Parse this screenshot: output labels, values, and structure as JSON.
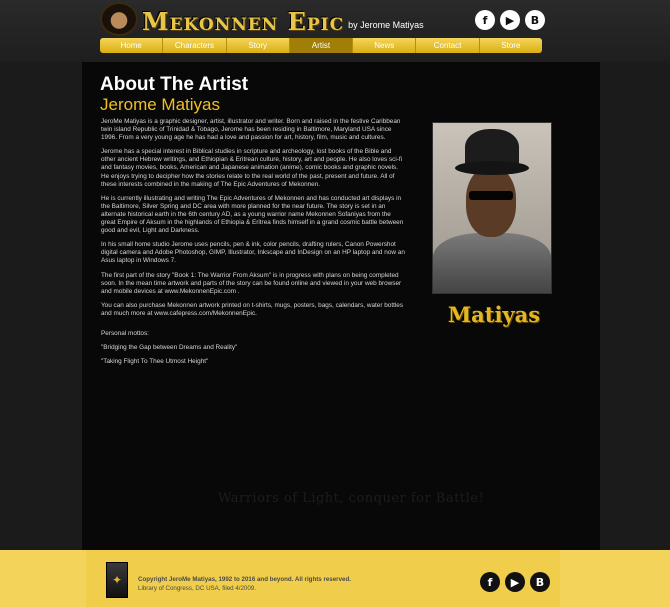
{
  "header": {
    "logo_text": "Mekonnen Epic",
    "byline": "by Jerome Matiyas",
    "social": [
      {
        "icon": "facebook-icon",
        "glyph": "f"
      },
      {
        "icon": "youtube-icon",
        "glyph": "▶"
      },
      {
        "icon": "blogger-icon",
        "glyph": "B"
      }
    ]
  },
  "nav": {
    "items": [
      "Home",
      "Characters",
      "Story",
      "Artist",
      "News",
      "Contact",
      "Store"
    ],
    "active": "Artist"
  },
  "main": {
    "title": "About The Artist",
    "artist_name": "Jerome Matiyas",
    "paragraphs": [
      "JeroMe Matiyas is a graphic designer, artist, illustrator and writer. Born and raised in the festive Caribbean twin island Republic of Trinidad & Tobago, Jerome has been residing in Baltimore, Maryland USA since 1996. From a very young age he has had a love and passion for art, history, film, music and cultures.",
      "Jerome has a special interest in Biblical studies in scripture and archeology, lost books of the Bible and other ancient Hebrew writings, and Ethiopian & Eritrean culture, history, art and people. He also loves sci-fi and fantasy movies, books, American and Japanese animation (anime), comic books and graphic novels. He enjoys trying to decipher how the stories relate to the real world of the past, present and future. All of these interests combined in the making of The Epic Adventures of Mekonnen.",
      "He is currently illustrating and writing The Epic Adventures of Mekonnen and has conducted art displays in the Baltimore, Silver Spring and DC area with more planned for the near future. The story is set in an alternate historical earth in the 6th century AD, as a young warrior name Mekonnen Sofaniyas from the great Empire of Aksum in the highlands of Ethiopia & Eritrea finds himself in a grand cosmic battle between good and evil, Light and Darkness.",
      "In his small home studio Jerome uses pencils, pen & ink, color pencils, drafting rulers, Canon Powershot digital camera and Adobe Photoshop, GIMP, Illustrator, Inkscape and InDesign on an HP laptop and now an Asus laptop in Windows 7.",
      "The first part of the story \"Book 1: The Warrior From Aksum\" is in progress with plans on being completed soon. In the mean time artwork and parts of the story can be found online and viewed in your web browser and mobile devices at www.MekonnenEpic.com .",
      "You can also purchase Mekonnen artwork printed on t-shirts, mugs, posters, bags, calendars, water bottles and much more at www.cafepress.com/MekonnenEpic."
    ],
    "mottos_heading": "Personal mottos:",
    "mottos": [
      "\"Bridging the Gap between Dreams and Reality\"",
      "\"Taking Flight To Thee Utmost Height\""
    ],
    "photo_alt_icon": "artist-portrait",
    "signature": "Matiyas",
    "watermark": "Warriors of Light, conquer for Battle!"
  },
  "footer": {
    "copyright_line1": "Copyright JeroMe Matiyas, 1992 to 2016 and beyond. All rights reserved.",
    "copyright_line2": "Library of Congress, DC USA, filed 4/2009.",
    "social": [
      {
        "icon": "facebook-icon",
        "glyph": "f"
      },
      {
        "icon": "youtube-icon",
        "glyph": "▶"
      },
      {
        "icon": "blogger-icon",
        "glyph": "B"
      }
    ]
  }
}
